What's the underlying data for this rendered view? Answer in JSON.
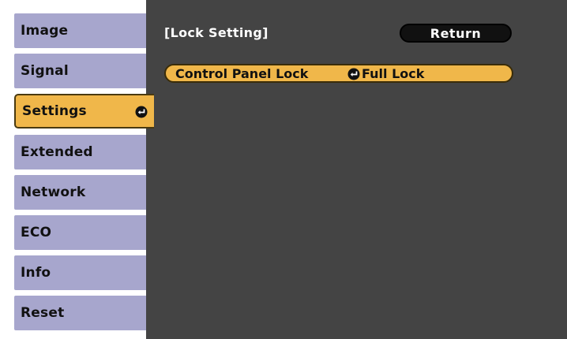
{
  "menu": {
    "items": [
      {
        "label": "Image"
      },
      {
        "label": "Signal"
      },
      {
        "label": "Settings"
      },
      {
        "label": "Extended"
      },
      {
        "label": "Network"
      },
      {
        "label": "ECO"
      },
      {
        "label": "Info"
      },
      {
        "label": "Reset"
      }
    ],
    "selected_index": 2
  },
  "header": {
    "title": "[Lock Setting]",
    "return_label": "Return"
  },
  "settings": [
    {
      "label": "Control Panel Lock",
      "value": "Full Lock"
    }
  ],
  "colors": {
    "menu_item": "#a7a6cd",
    "highlight": "#f0b74a",
    "panel": "#444444",
    "button": "#111111"
  },
  "icons": {
    "enter": "enter-arrow-icon"
  }
}
